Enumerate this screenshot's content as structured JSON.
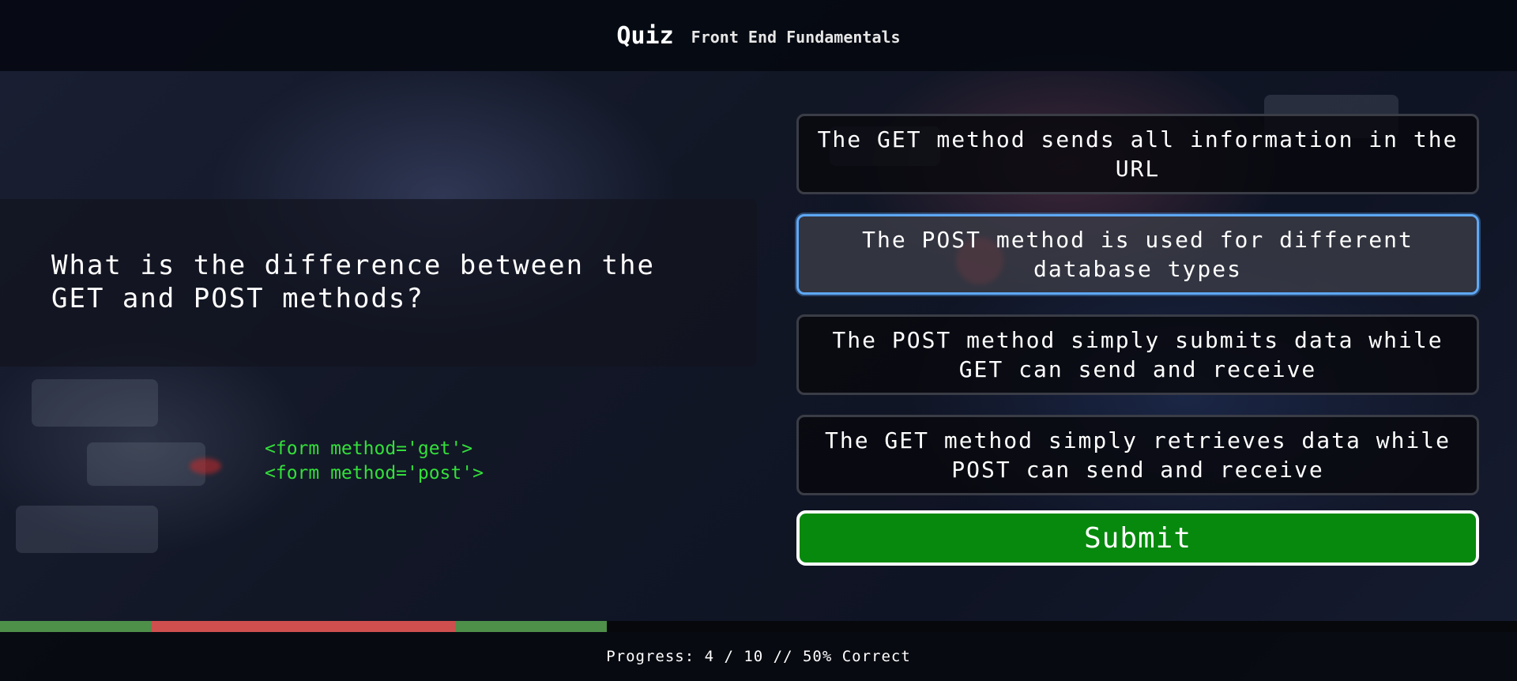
{
  "header": {
    "title": "Quiz",
    "subtitle": "Front End Fundamentals"
  },
  "question": {
    "text": "What is the difference between the GET and POST methods?",
    "code_lines": [
      "<form method='get'>",
      "<form method='post'>"
    ]
  },
  "answers": [
    {
      "label": "The GET method sends all information in the URL",
      "selected": false
    },
    {
      "label": "The POST method is used for different database types",
      "selected": true
    },
    {
      "label": "The POST method simply submits data while GET can send and receive",
      "selected": false
    },
    {
      "label": "The GET method simply retrieves data while POST can send and receive",
      "selected": false
    }
  ],
  "submit_label": "Submit",
  "progress": {
    "text": "Progress: 4 / 10 // 50% Correct",
    "answered": 4,
    "total": 10,
    "results": [
      "correct",
      "incorrect",
      "incorrect",
      "correct"
    ],
    "colors": {
      "correct": "#4e8f4a",
      "incorrect": "#cf4f4f",
      "selected_border": "#5ea8f5",
      "submit_bg": "#06890d",
      "code_text": "#33e03a"
    }
  }
}
